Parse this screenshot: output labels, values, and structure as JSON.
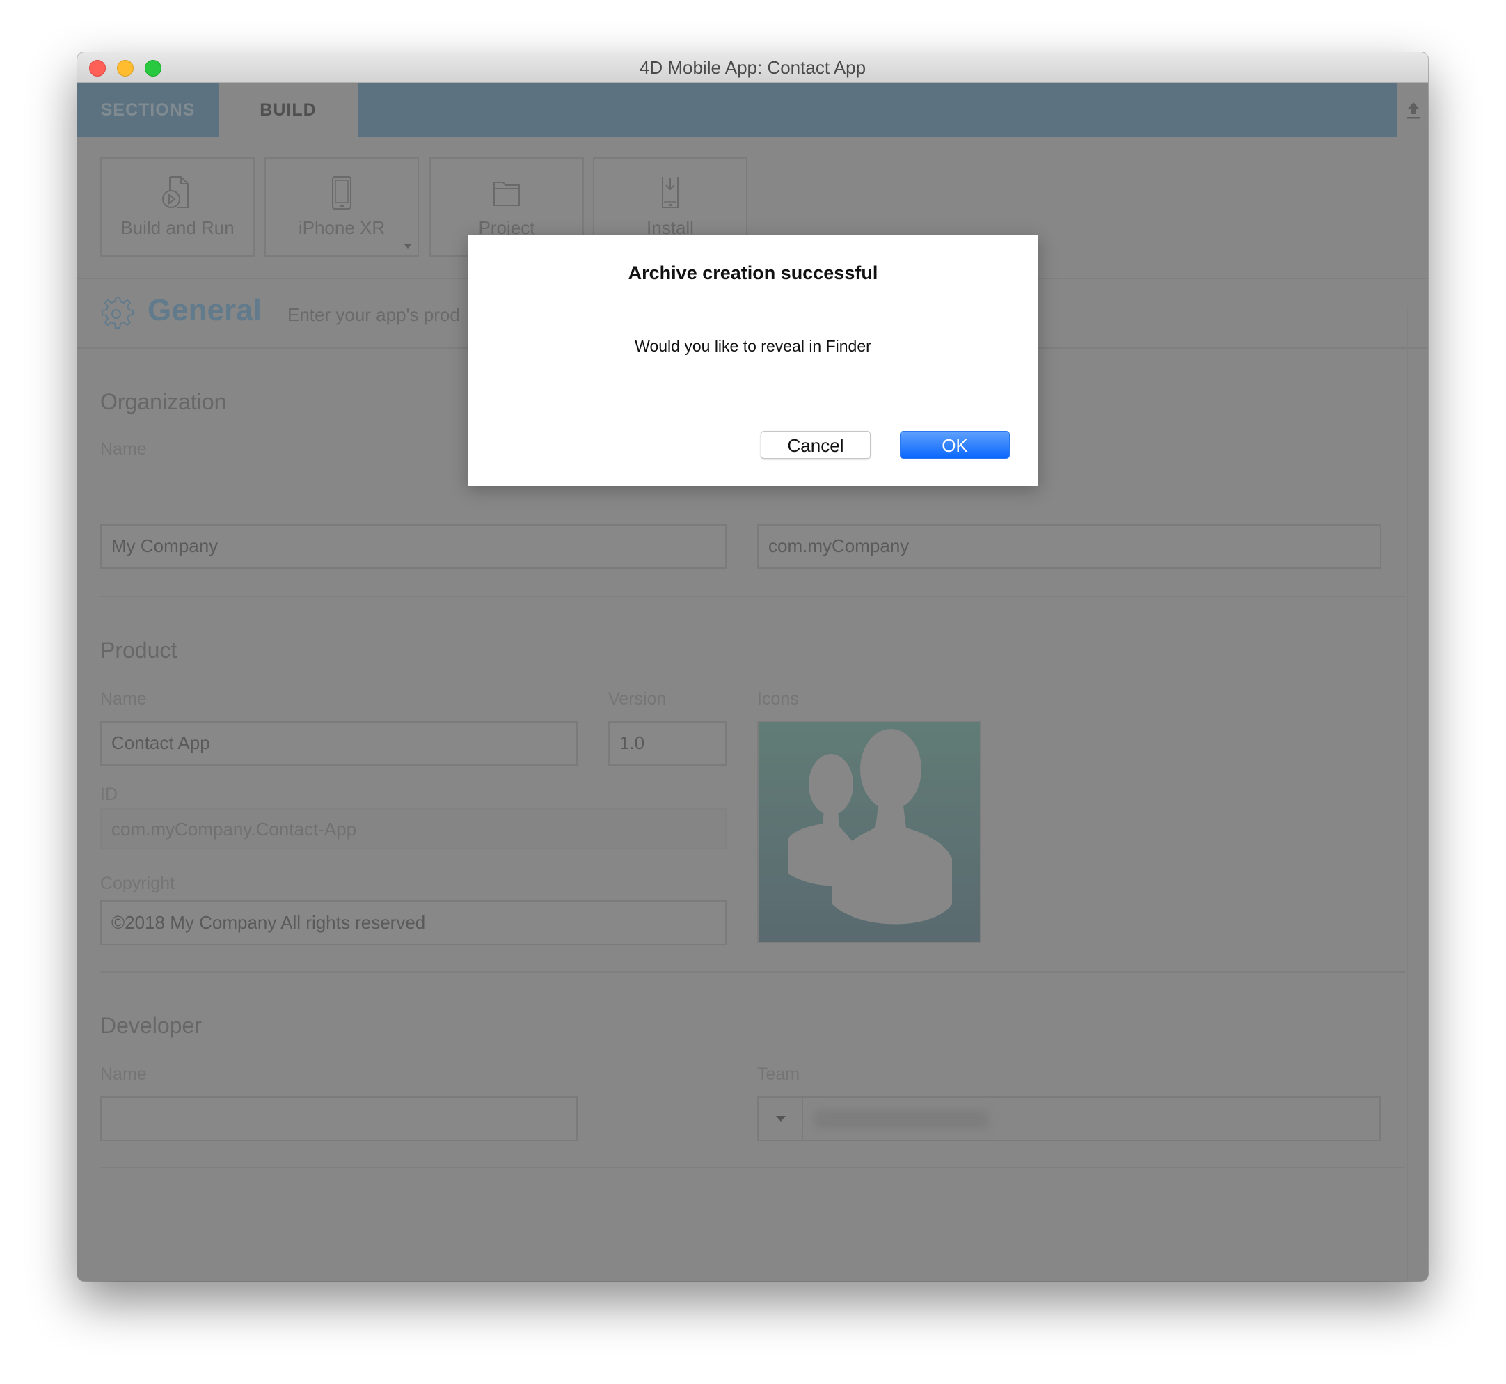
{
  "window": {
    "title": "4D Mobile App: Contact App"
  },
  "tabs": [
    {
      "label": "SECTIONS",
      "active": false
    },
    {
      "label": "BUILD",
      "active": true
    }
  ],
  "toolbar": {
    "buttons": [
      {
        "label": "Build and Run",
        "icon": "build-run-icon"
      },
      {
        "label": "iPhone XR",
        "icon": "iphone-icon",
        "has_dropdown": true
      },
      {
        "label": "Project",
        "icon": "folder-icon"
      },
      {
        "label": "Install",
        "icon": "install-phone-icon"
      }
    ],
    "upload_icon": "upload-icon"
  },
  "header": {
    "title": "General",
    "description": "Enter your app's prod",
    "icon": "gear-icon"
  },
  "organization": {
    "heading": "Organization",
    "name_label": "Name",
    "name_value": "My Company",
    "identifier_value": "com.myCompany"
  },
  "product": {
    "heading": "Product",
    "name_label": "Name",
    "name_value": "Contact App",
    "version_label": "Version",
    "version_value": "1.0",
    "icons_label": "Icons",
    "id_label": "ID",
    "id_value": "com.myCompany.Contact-App",
    "copyright_label": "Copyright",
    "copyright_value": "©2018 My Company All rights reserved"
  },
  "developer": {
    "heading": "Developer",
    "name_label": "Name",
    "name_value": "",
    "team_label": "Team"
  },
  "dialog": {
    "title": "Archive creation successful",
    "message": "Would you like to reveal in Finder",
    "cancel_label": "Cancel",
    "ok_label": "OK"
  },
  "colors": {
    "tab_bar": "#5c7280",
    "accent": "#617a8c",
    "ok_button": "#0a67fd",
    "close": "#fe5f57",
    "minimize": "#febc2e",
    "maximize": "#28c840"
  }
}
